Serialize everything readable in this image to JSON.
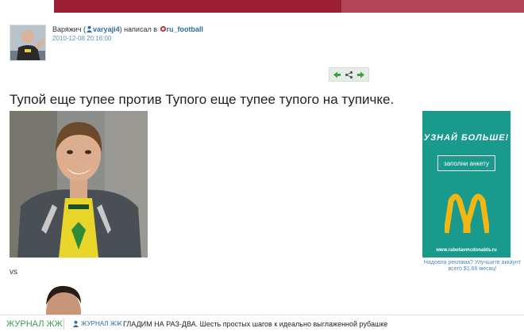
{
  "post": {
    "author": "Варяжич",
    "username": "varyaji4",
    "wrote_in": "написал в",
    "community": "ru_football",
    "date": "2010-12-08 20:16:00",
    "title": "Тупой еще тупее против Тупого еще тупее тупого на тупичке.",
    "vs": "vs"
  },
  "ad": {
    "headline": "УЗНАЙ БОЛЬШЕ!",
    "button": "заполни анкету",
    "site": "www.rabotavmcdonalds.ru",
    "note": "Надоела реклама? Улучшите аккаунт всего $1.66 месяц!"
  },
  "footer": {
    "brand": "ЖУРНАЛ ЖЖ",
    "user": "ЖУРНАЛ ЖЖ",
    "headline": "ГЛАДИМ НА РАЗ-ДВА. Шесть простых шагов к идеально выглаженной рубашке"
  },
  "colors": {
    "top_bar": "#9c1e33",
    "link": "#2a6fa8",
    "ad_bg": "#1a9a8d",
    "brand_green": "#3aa04c"
  }
}
